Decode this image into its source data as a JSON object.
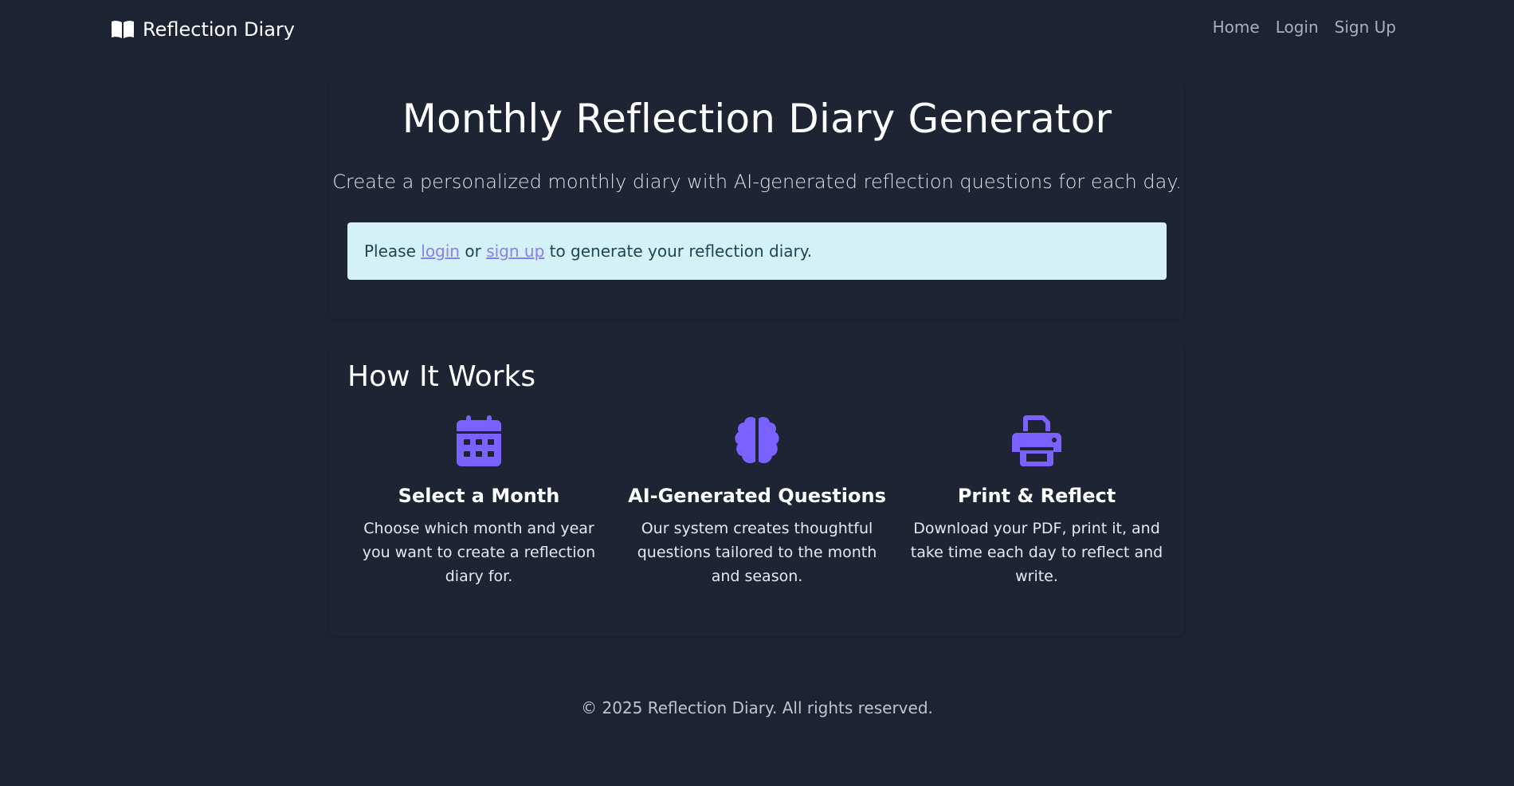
{
  "nav": {
    "brand": "Reflection Diary",
    "brand_icon": "open-book-icon",
    "links": [
      {
        "label": "Home"
      },
      {
        "label": "Login"
      },
      {
        "label": "Sign Up"
      }
    ]
  },
  "hero": {
    "title": "Monthly Reflection Diary Generator",
    "subtitle": "Create a personalized monthly diary with AI-generated reflection questions for each day."
  },
  "alert": {
    "prefix": "Please ",
    "login_link": "login",
    "middle": " or ",
    "signup_link": "sign up",
    "suffix": " to generate your reflection diary."
  },
  "how_it_works": {
    "title": "How It Works",
    "features": [
      {
        "icon": "calendar-icon",
        "title": "Select a Month",
        "text": "Choose which month and year you want to create a reflection diary for."
      },
      {
        "icon": "brain-icon",
        "title": "AI-Generated Questions",
        "text": "Our system creates thoughtful questions tailored to the month and season."
      },
      {
        "icon": "printer-icon",
        "title": "Print & Reflect",
        "text": "Download your PDF, print it, and take time each day to reflect and write."
      }
    ]
  },
  "footer": {
    "text": "© 2025 Reflection Diary. All rights reserved."
  },
  "colors": {
    "background": "#1d2333",
    "accent": "#7b61ff",
    "alert_bg": "#d3f1f6",
    "link": "#8e7cf0"
  }
}
